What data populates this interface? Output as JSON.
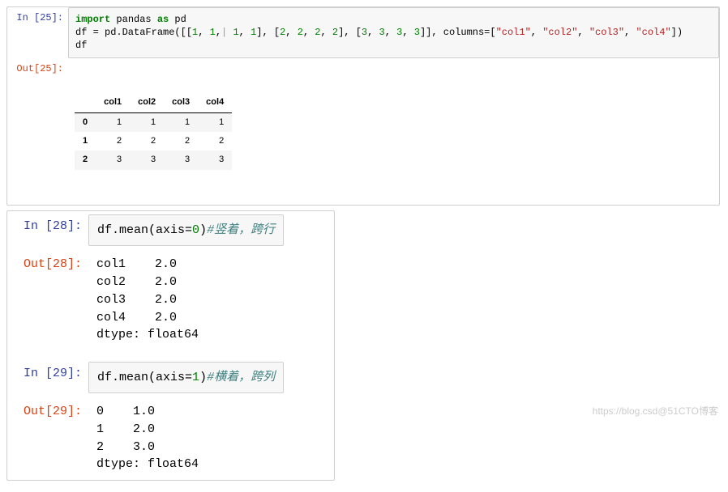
{
  "cells": {
    "c25": {
      "in_prompt": "In [25]:",
      "out_prompt": "Out[25]:",
      "code_tokens": {
        "import": "import",
        "pandas": " pandas ",
        "as": "as",
        "pd": " pd",
        "line2_a": "df = pd.DataFrame([[",
        "n1a": "1",
        "sep": ", ",
        "n1b": "1",
        "cur": "|",
        "n1c": "1",
        "n1d": "1",
        "br1": "], [",
        "n2a": "2",
        "n2b": "2",
        "n2c": "2",
        "n2d": "2",
        "br2": "], [",
        "n3a": "3",
        "n3b": "3",
        "n3c": "3",
        "n3d": "3",
        "br3": "]], columns=[",
        "s1": "\"col1\"",
        "s2": "\"col2\"",
        "s3": "\"col3\"",
        "s4": "\"col4\"",
        "end": "])",
        "line3": "df"
      },
      "table": {
        "columns": [
          "col1",
          "col2",
          "col3",
          "col4"
        ],
        "index": [
          "0",
          "1",
          "2"
        ],
        "rows": [
          [
            "1",
            "1",
            "1",
            "1"
          ],
          [
            "2",
            "2",
            "2",
            "2"
          ],
          [
            "3",
            "3",
            "3",
            "3"
          ]
        ]
      }
    },
    "c28": {
      "in_prompt": "In [28]:",
      "out_prompt": "Out[28]:",
      "code_pre": "df.mean(axis=",
      "code_num": "0",
      "code_post": ")",
      "code_comment": "#竖着，跨行",
      "output": "col1    2.0\ncol2    2.0\ncol3    2.0\ncol4    2.0\ndtype: float64"
    },
    "c29": {
      "in_prompt": "In [29]:",
      "out_prompt": "Out[29]:",
      "code_pre": "df.mean(axis=",
      "code_num": "1",
      "code_post": ")",
      "code_comment": "#横着，跨列",
      "output": "0    1.0\n1    2.0\n2    3.0\ndtype: float64"
    }
  },
  "watermark": "https://blog.csd@51CTO博客",
  "chart_data": {
    "type": "table",
    "title": "pandas DataFrame df",
    "columns": [
      "col1",
      "col2",
      "col3",
      "col4"
    ],
    "index": [
      0,
      1,
      2
    ],
    "data": [
      [
        1,
        1,
        1,
        1
      ],
      [
        2,
        2,
        2,
        2
      ],
      [
        3,
        3,
        3,
        3
      ]
    ],
    "derived": {
      "mean_axis0": {
        "col1": 2.0,
        "col2": 2.0,
        "col3": 2.0,
        "col4": 2.0
      },
      "mean_axis1": {
        "0": 1.0,
        "1": 2.0,
        "2": 3.0
      }
    }
  }
}
